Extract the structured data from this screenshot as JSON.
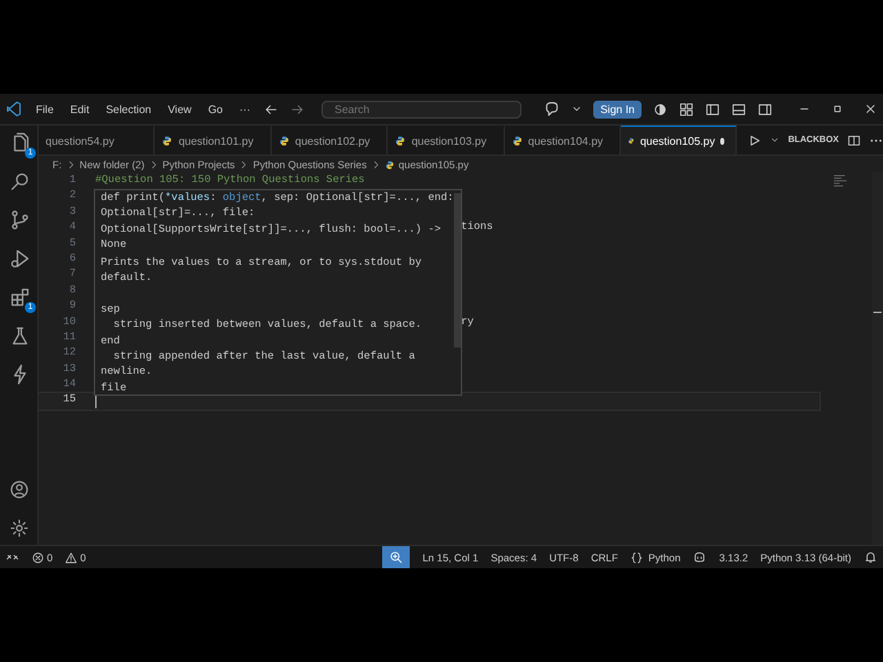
{
  "title_bar": {
    "menu": [
      {
        "label": "File"
      },
      {
        "label": "Edit"
      },
      {
        "label": "Selection"
      },
      {
        "label": "View"
      },
      {
        "label": "Go"
      },
      {
        "label": "···"
      }
    ],
    "search": {
      "placeholder": "Search"
    },
    "sign_in": "Sign In"
  },
  "activity_bar": {
    "items": [
      {
        "kind": "files",
        "badge": "1",
        "selected": false
      },
      {
        "kind": "search",
        "selected": false
      },
      {
        "kind": "source-control",
        "selected": false
      },
      {
        "kind": "run",
        "selected": false
      },
      {
        "kind": "extensions",
        "badge": "1",
        "selected": false
      },
      {
        "kind": "testing",
        "selected": false
      },
      {
        "kind": "bolt",
        "selected": false
      }
    ],
    "bottom": [
      {
        "kind": "account"
      },
      {
        "kind": "settings"
      }
    ]
  },
  "tabs": [
    {
      "label": "question54.py",
      "python_icon": false,
      "selected": false,
      "modified": false
    },
    {
      "label": "question101.py",
      "python_icon": true,
      "selected": false,
      "modified": false
    },
    {
      "label": "question102.py",
      "python_icon": true,
      "selected": false,
      "modified": false
    },
    {
      "label": "question103.py",
      "python_icon": true,
      "selected": false,
      "modified": false
    },
    {
      "label": "question104.py",
      "python_icon": true,
      "selected": false,
      "modified": false
    },
    {
      "label": "question105.py",
      "python_icon": true,
      "selected": true,
      "modified": true
    }
  ],
  "editor_actions": {
    "extension": "BLACKBOX"
  },
  "breadcrumb": [
    {
      "label": "F:",
      "python_icon": false
    },
    {
      "label": "New folder (2)",
      "python_icon": false
    },
    {
      "label": "Python Projects",
      "python_icon": false
    },
    {
      "label": "Python Questions Series",
      "python_icon": false
    },
    {
      "label": "question105.py",
      "python_icon": true
    }
  ],
  "editor": {
    "lines": [
      {
        "number": "1",
        "text": "#Question 105: 150 Python Questions Series",
        "covered_start": false,
        "active": false
      },
      {
        "number": "2",
        "active": false
      },
      {
        "number": "3",
        "active": false
      },
      {
        "number": "4",
        "text": "tions",
        "covered_start": true,
        "active": false
      },
      {
        "number": "5",
        "active": false
      },
      {
        "number": "6",
        "active": false
      },
      {
        "number": "7",
        "active": false
      },
      {
        "number": "8",
        "active": false
      },
      {
        "number": "9",
        "active": false
      },
      {
        "number": "10",
        "text": "ry",
        "covered_start": true,
        "active": false
      },
      {
        "number": "11",
        "active": false
      },
      {
        "number": "12",
        "active": false
      },
      {
        "number": "13",
        "active": false
      },
      {
        "number": "14",
        "active": false
      },
      {
        "number": "15",
        "active": true
      }
    ],
    "hover": {
      "signature": [
        [
          {
            "text": "def print(",
            "kind": "plain"
          },
          {
            "text": "*values",
            "kind": "param"
          },
          {
            "text": ": ",
            "kind": "plain"
          },
          {
            "text": "object",
            "kind": "type"
          },
          {
            "text": ", sep: Optional[str]=..., end:",
            "kind": "plain"
          }
        ],
        [
          {
            "text": "Optional[str]=..., file:",
            "kind": "plain"
          }
        ],
        [
          {
            "text": "Optional[SupportsWrite[str]]=..., flush: bool=...) ->",
            "kind": "plain"
          }
        ],
        [
          {
            "text": "None",
            "kind": "plain"
          }
        ]
      ],
      "doc": [
        {
          "text": "Prints the values to a stream, or to sys.stdout by",
          "gap_before": false
        },
        {
          "text": "default.",
          "gap_before": false
        },
        {
          "text": "sep",
          "gap_before": true
        },
        {
          "text": "  string inserted between values, default a space.",
          "gap_before": false
        },
        {
          "text": "end",
          "gap_before": false
        },
        {
          "text": "  string appended after the last value, default a",
          "gap_before": false
        },
        {
          "text": "newline.",
          "gap_before": false
        },
        {
          "text": "file",
          "gap_before": false
        }
      ]
    }
  },
  "status_bar": {
    "left": [
      {
        "kind": "remote"
      },
      {
        "kind": "errors",
        "text": "0"
      },
      {
        "kind": "warnings",
        "text": "0"
      }
    ],
    "right": [
      {
        "kind": "zoom",
        "selected": true
      },
      {
        "kind": "text",
        "text": "Ln 15, Col 1"
      },
      {
        "kind": "text",
        "text": "Spaces: 4"
      },
      {
        "kind": "text",
        "text": "UTF-8"
      },
      {
        "kind": "text",
        "text": "CRLF"
      },
      {
        "kind": "language",
        "text": "Python"
      },
      {
        "kind": "copilot"
      },
      {
        "kind": "text",
        "text": "3.13.2"
      },
      {
        "kind": "text",
        "text": "Python 3.13 (64-bit)"
      },
      {
        "kind": "bell"
      }
    ]
  }
}
